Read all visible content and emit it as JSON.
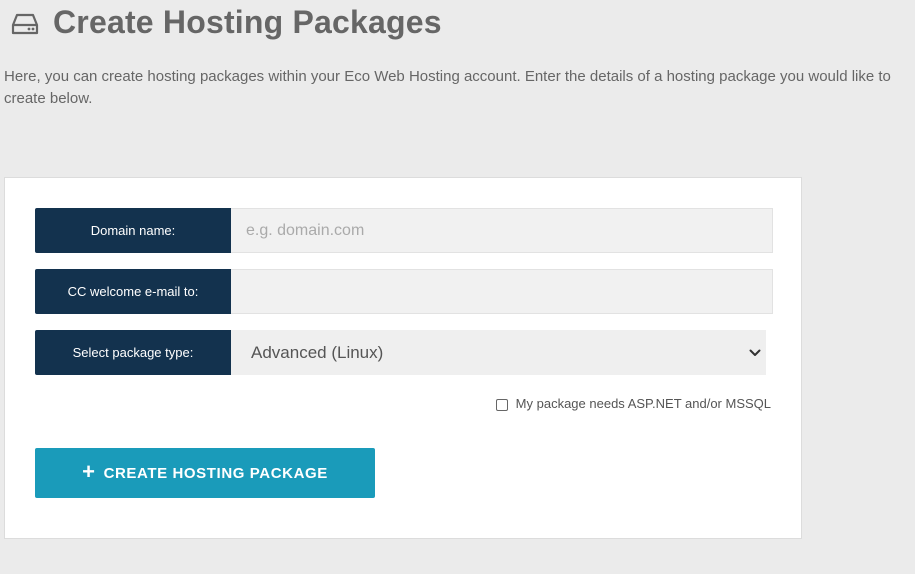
{
  "header": {
    "icon": "hard-drive-icon",
    "title": "Create Hosting Packages"
  },
  "intro": {
    "line1": "Here, you can create hosting packages within your Eco Web Hosting account. Enter the details of a hosting package you would like to",
    "line2": "create below."
  },
  "form": {
    "domain": {
      "label": "Domain name:",
      "placeholder": "e.g. domain.com",
      "value": ""
    },
    "cc_email": {
      "label": "CC welcome e-mail to:",
      "placeholder": "",
      "value": ""
    },
    "package_type": {
      "label": "Select package type:",
      "selected": "Advanced (Linux)",
      "icon": "chevron-down-icon"
    },
    "aspnet_checkbox": {
      "label": "My package needs ASP.NET and/or MSSQL",
      "checked": false
    },
    "submit": {
      "icon": "plus-icon",
      "plus": "+",
      "label": "CREATE HOSTING PACKAGE"
    }
  },
  "colors": {
    "label_bg": "#13324e",
    "button_bg": "#1a9bba",
    "page_bg": "#ebebeb"
  }
}
